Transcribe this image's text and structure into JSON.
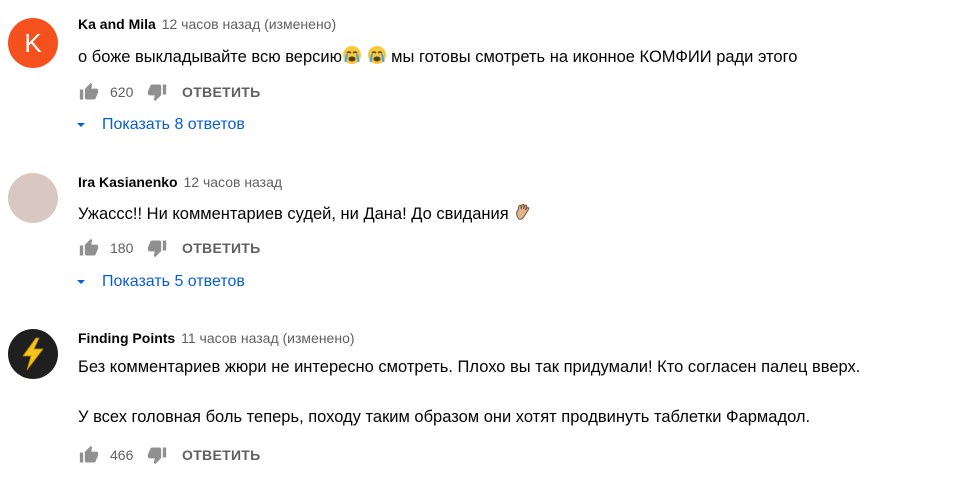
{
  "comments": [
    {
      "author": "Ka and Mila",
      "time": "12 часов назад (изменено)",
      "avatar_letter": "K",
      "avatar_color": "#f4511e",
      "text_before_emoji": "о боже выкладывайте всю версию",
      "text_after_emoji": " мы готовы смотреть на иконное КОМФИИ ради этого",
      "emoji": [
        "crying-face-icon",
        "crying-face-icon"
      ],
      "likes": "620",
      "reply_label": "ОТВЕТИТЬ",
      "replies_label": "Показать 8 ответов"
    },
    {
      "author": "Ira Kasianenko",
      "time": "12 часов назад",
      "avatar_color": "#d9c7c1",
      "text": "Ужассс!! Ни комментариев судей, ни Дана! До свидания ",
      "emoji": [
        "waving-hand-icon"
      ],
      "likes": "180",
      "reply_label": "ОТВЕТИТЬ",
      "replies_label": "Показать 5 ответов"
    },
    {
      "author": "Finding Points",
      "time": "11 часов назад (изменено)",
      "avatar_icon": "lightning-bolt-icon",
      "avatar_color": "#1f1f1f",
      "text_line1": "Без комментариев жюри не интересно смотреть. Плохо вы так придумали! Кто согласен палец вверх.",
      "text_line2": "У всех головная боль теперь, походу таким образом они хотят продвинуть таблетки Фармадол.",
      "likes": "466",
      "reply_label": "ОТВЕТИТЬ"
    }
  ],
  "colors": {
    "link_blue": "#065fd4",
    "meta_gray": "#606060",
    "icon_gray": "#909090"
  }
}
